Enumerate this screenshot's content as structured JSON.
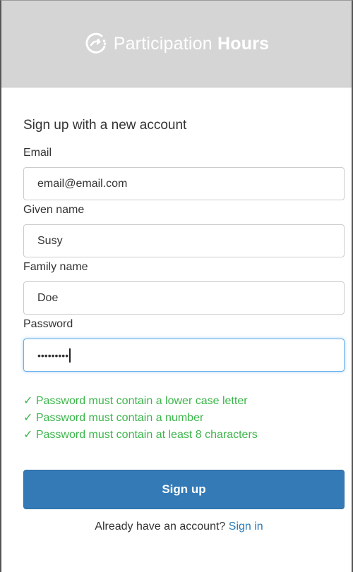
{
  "brand": {
    "name_light": "Participation",
    "name_bold": "Hours",
    "icon": "participation-logo-icon",
    "banner_color": "#d5d5d5"
  },
  "form": {
    "heading": "Sign up with a new account",
    "email_label": "Email",
    "email_value": "email@email.com",
    "given_name_label": "Given name",
    "given_name_value": "Susy",
    "family_name_label": "Family name",
    "family_name_value": "Doe",
    "password_label": "Password",
    "password_mask": "•••••••••"
  },
  "password_rules": [
    "✓ Password must contain a lower case letter",
    "✓ Password must contain a number",
    "✓ Password must contain at least 8 characters"
  ],
  "actions": {
    "signup_label": "Sign up",
    "signin_prompt": "Already have an account?",
    "signin_link": "Sign in"
  },
  "colors": {
    "primary": "#337ab7",
    "success": "#3bb54a",
    "link": "#2a7ab8",
    "focus": "#66afe9"
  }
}
